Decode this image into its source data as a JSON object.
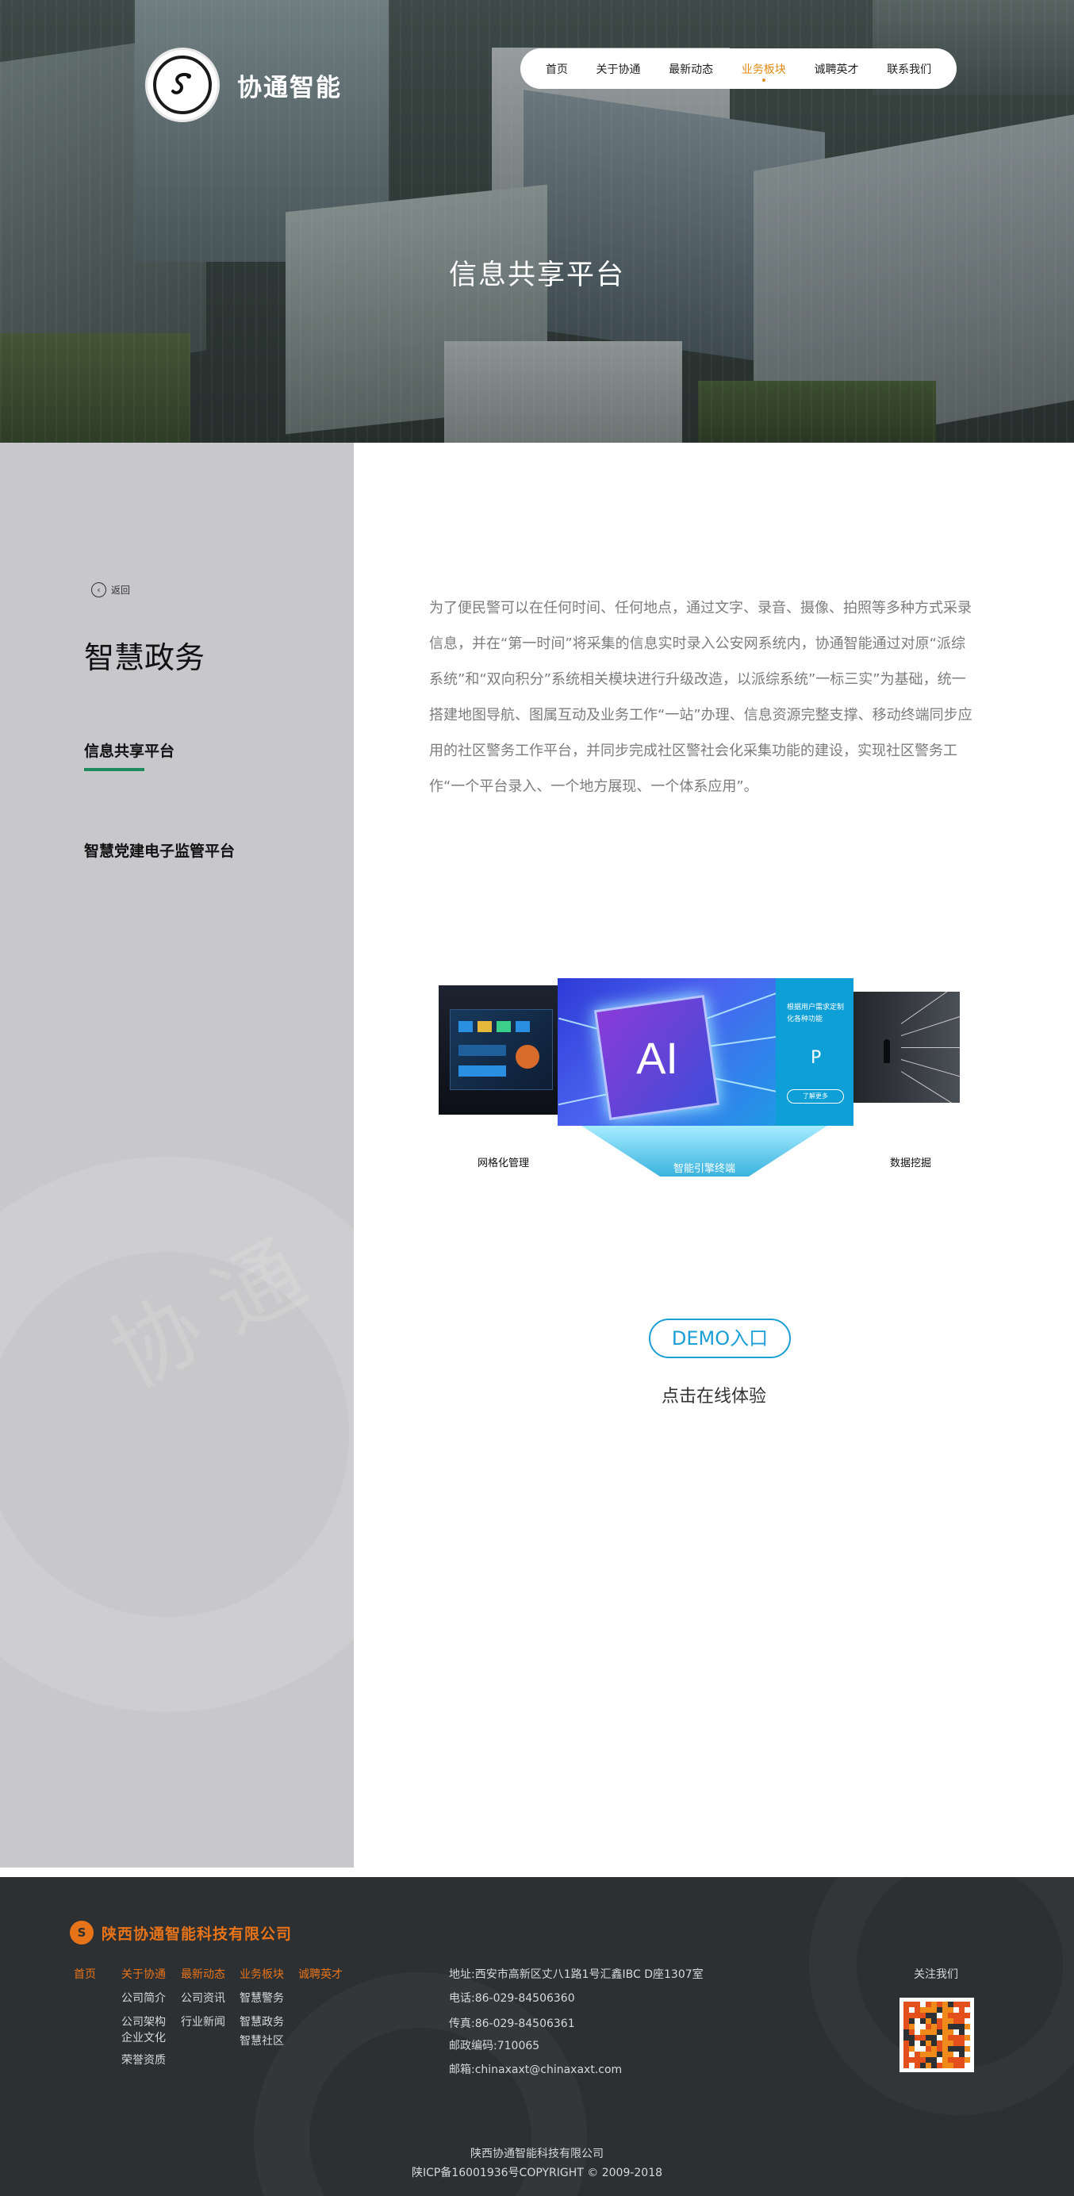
{
  "header": {
    "logo_text": "协通智能",
    "nav": [
      {
        "label": "首页",
        "active": false
      },
      {
        "label": "关于协通",
        "active": false
      },
      {
        "label": "最新动态",
        "active": false
      },
      {
        "label": "业务板块",
        "active": true
      },
      {
        "label": "诚聘英才",
        "active": false
      },
      {
        "label": "联系我们",
        "active": false
      }
    ],
    "hero_title": "信息共享平台",
    "accent_color": "#e08a12"
  },
  "sidebar": {
    "back_label": "返回",
    "title": "智慧政务",
    "items": [
      {
        "label": "信息共享平台",
        "active": true
      },
      {
        "label": "智慧党建电子监管平台",
        "active": false
      }
    ],
    "active_underline_color": "#1d8b5e"
  },
  "main": {
    "description": "为了便民警可以在任何时间、任何地点，通过文字、录音、摄像、拍照等多种方式采录信息，并在“第一时间”将采集的信息实时录入公安网系统内，协通智能通过对原“派综系统”和“双向积分”系统相关模块进行升级改造，以派综系统”一标三实”为基础，统一搭建地图导航、图属互动及业务工作“一站”办理、信息资源完整支撑、移动终端同步应用的社区警务工作平台，并同步完成社区警社会化采集功能的建设，实现社区警务工作“一个平台录入、一个地方展现、一个体系应用”。",
    "showcase": {
      "left_caption": "网格化管理",
      "center_caption": "智能引擎终端",
      "right_caption": "数据挖掘",
      "chip_label": "AI",
      "side_panel_text": "根据用户需求定制化各种功能",
      "side_panel_letter": "P",
      "side_panel_button": "了解更多"
    },
    "demo_button": "DEMO入口",
    "demo_subtitle": "点击在线体验",
    "demo_color": "#1b9fd6"
  },
  "footer": {
    "company_logo_text": "陕西协通智能科技有限公司",
    "nav": [
      "首页",
      "关于协通",
      "最新动态",
      "业务板块",
      "诚聘英才"
    ],
    "about_links": [
      "公司简介",
      "公司架构",
      "企业文化",
      "荣誉资质"
    ],
    "news_links": [
      "公司资讯",
      "行业新闻"
    ],
    "business_links": [
      "智慧警务",
      "智慧政务",
      "智慧社区"
    ],
    "contact": {
      "address": "地址:西安市高新区丈八1路1号汇鑫IBC D座1307室",
      "phone": "电话:86-029-84506360",
      "fax": "传真:86-029-84506361",
      "postcode": "邮政编码:710065",
      "email": "邮箱:chinaxaxt@chinaxaxt.com"
    },
    "follow_label": "关注我们",
    "copyright_company": "陕西协通智能科技有限公司",
    "copyright_line": "陕ICP备16001936号COPYRIGHT © 2009-2018",
    "accent_color": "#e77319"
  }
}
